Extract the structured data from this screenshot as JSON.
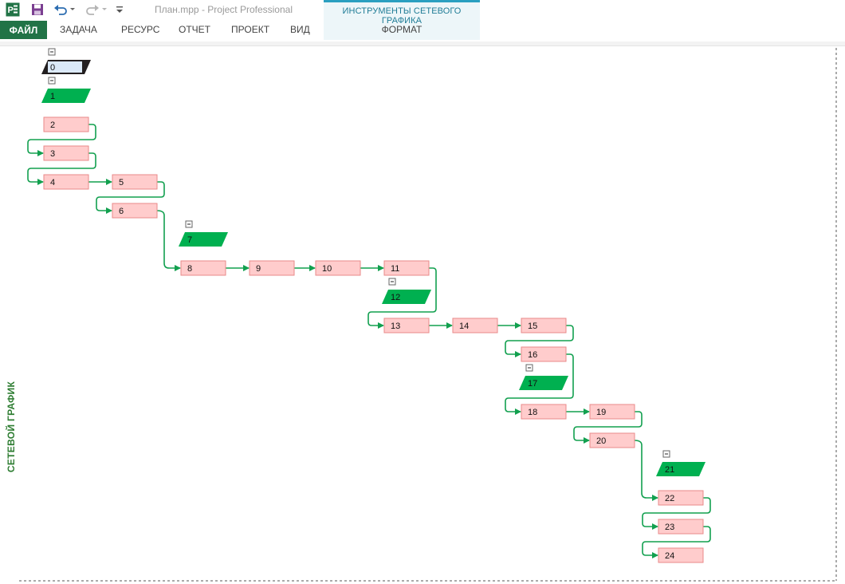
{
  "window": {
    "title": "План.mpp - Project Professional",
    "tools_header": "ИНСТРУМЕНТЫ СЕТЕВОГО ГРАФИКА"
  },
  "qat": {
    "app_icon": "project-app-icon",
    "save_icon": "save-icon",
    "undo_icon": "undo-icon",
    "redo_icon": "redo-icon",
    "customize_icon": "customize-qat-icon"
  },
  "tabs": {
    "file": "ФАЙЛ",
    "task": "ЗАДАЧА",
    "resource": "РЕСУРС",
    "report": "ОТЧЕТ",
    "project": "ПРОЕКТ",
    "view": "ВИД",
    "format": "ФОРМАТ"
  },
  "view_label": "СЕТЕВОЙ ГРАФИК",
  "colors": {
    "summary_fill": "#00b050",
    "task_fill": "#ffcccc",
    "task_border": "#e88a8a",
    "link": "#12a04f",
    "file_tab": "#217346",
    "tools_accent": "#2a9fc0"
  },
  "network": {
    "nodes": [
      {
        "id": "0",
        "kind": "project-summary"
      },
      {
        "id": "1",
        "kind": "summary"
      },
      {
        "id": "2",
        "kind": "task"
      },
      {
        "id": "3",
        "kind": "task"
      },
      {
        "id": "4",
        "kind": "task"
      },
      {
        "id": "5",
        "kind": "task"
      },
      {
        "id": "6",
        "kind": "task"
      },
      {
        "id": "7",
        "kind": "summary"
      },
      {
        "id": "8",
        "kind": "task"
      },
      {
        "id": "9",
        "kind": "task"
      },
      {
        "id": "10",
        "kind": "task"
      },
      {
        "id": "11",
        "kind": "task"
      },
      {
        "id": "12",
        "kind": "summary"
      },
      {
        "id": "13",
        "kind": "task"
      },
      {
        "id": "14",
        "kind": "task"
      },
      {
        "id": "15",
        "kind": "task"
      },
      {
        "id": "16",
        "kind": "task"
      },
      {
        "id": "17",
        "kind": "summary"
      },
      {
        "id": "18",
        "kind": "task"
      },
      {
        "id": "19",
        "kind": "task"
      },
      {
        "id": "20",
        "kind": "task"
      },
      {
        "id": "21",
        "kind": "summary"
      },
      {
        "id": "22",
        "kind": "task"
      },
      {
        "id": "23",
        "kind": "task"
      },
      {
        "id": "24",
        "kind": "task"
      }
    ],
    "links": [
      [
        "2",
        "3"
      ],
      [
        "3",
        "4"
      ],
      [
        "4",
        "5"
      ],
      [
        "5",
        "6"
      ],
      [
        "6",
        "8"
      ],
      [
        "8",
        "9"
      ],
      [
        "9",
        "10"
      ],
      [
        "10",
        "11"
      ],
      [
        "11",
        "13"
      ],
      [
        "13",
        "14"
      ],
      [
        "14",
        "15"
      ],
      [
        "15",
        "16"
      ],
      [
        "16",
        "18"
      ],
      [
        "18",
        "19"
      ],
      [
        "19",
        "20"
      ],
      [
        "20",
        "22"
      ],
      [
        "22",
        "23"
      ],
      [
        "23",
        "24"
      ]
    ],
    "collapse_symbol": "−"
  }
}
